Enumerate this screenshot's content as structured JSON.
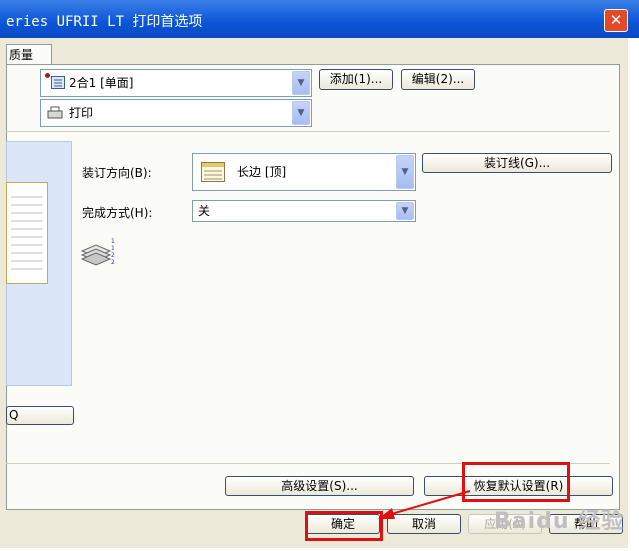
{
  "window": {
    "title": "eries UFRII LT 打印首选项",
    "close_label": "✕"
  },
  "tabs": [
    {
      "label": "质量"
    }
  ],
  "profile": {
    "selected": "2合1 [单面]",
    "add_label": "添加(1)...",
    "edit_label": "编辑(2)..."
  },
  "output": {
    "selected": "打印"
  },
  "binding": {
    "label": "装订方向(B):",
    "selected": "长边 [顶]",
    "gutter_label": "装订线(G)..."
  },
  "finishing": {
    "label": "完成方式(H):",
    "selected": "关"
  },
  "preview": {
    "button_label": "Q"
  },
  "advanced_label": "高级设置(S)...",
  "restore_label": "恢复默认设置(R)",
  "footer": {
    "ok": "确定",
    "cancel": "取消",
    "apply": "应用(A)",
    "help": "帮助"
  },
  "watermark": "Baidu 经验",
  "colors": {
    "highlight": "#e01010",
    "titlebar": "#0b55d6"
  }
}
